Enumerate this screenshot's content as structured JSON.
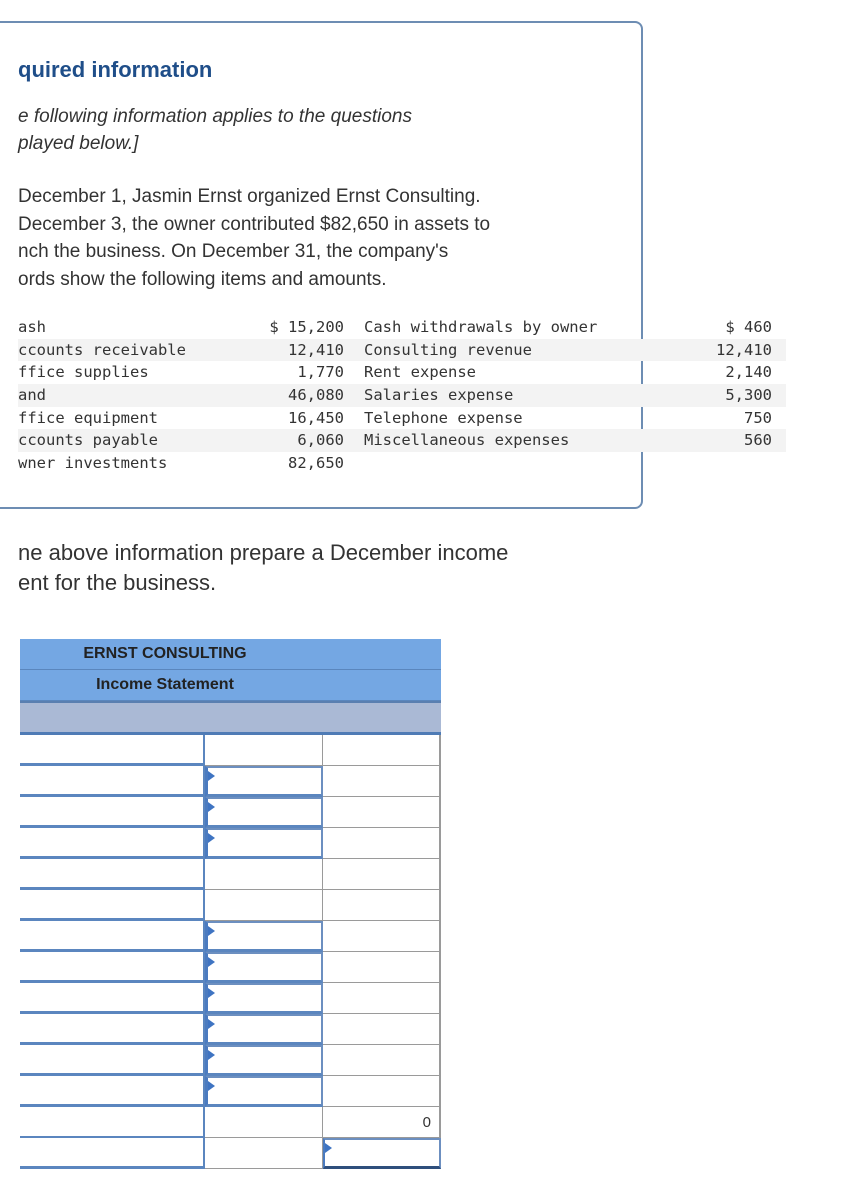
{
  "info_box": {
    "heading": "quired information",
    "intro_lines": [
      "e following information applies to the questions",
      "played below.]"
    ],
    "story_lines": [
      " December 1, Jasmin Ernst organized Ernst Consulting.",
      " December 3, the owner contributed $82,650 in assets to",
      "nch the business. On December 31, the company's",
      "ords show the following items and amounts."
    ],
    "items": [
      {
        "left_label": "ash",
        "left_amount": "$ 15,200",
        "right_label": "Cash withdrawals by owner",
        "right_amount": "$ 460"
      },
      {
        "left_label": "ccounts receivable",
        "left_amount": "12,410",
        "right_label": "Consulting revenue",
        "right_amount": "12,410"
      },
      {
        "left_label": "ffice supplies",
        "left_amount": "1,770",
        "right_label": "Rent expense",
        "right_amount": "2,140"
      },
      {
        "left_label": "and",
        "left_amount": "46,080",
        "right_label": "Salaries expense",
        "right_amount": "5,300"
      },
      {
        "left_label": "ffice equipment",
        "left_amount": "16,450",
        "right_label": "Telephone expense",
        "right_amount": "750"
      },
      {
        "left_label": "ccounts payable",
        "left_amount": "6,060",
        "right_label": "Miscellaneous expenses",
        "right_amount": "560"
      },
      {
        "left_label": "wner investments",
        "left_amount": "82,650",
        "right_label": "",
        "right_amount": ""
      }
    ]
  },
  "instruction_lines": [
    "ne above information prepare a December income",
    "ent for the business."
  ],
  "statement": {
    "company": "ERNST CONSULTING",
    "title": "Income Statement",
    "date_label": "",
    "rows": [
      {
        "mid_input": false,
        "right_input": false,
        "right_value": ""
      },
      {
        "mid_input": true,
        "right_input": false,
        "right_value": ""
      },
      {
        "mid_input": true,
        "right_input": false,
        "right_value": ""
      },
      {
        "mid_input": true,
        "right_input": false,
        "right_value": ""
      },
      {
        "mid_input": false,
        "right_input": false,
        "right_value": ""
      },
      {
        "mid_input": false,
        "right_input": false,
        "right_value": ""
      },
      {
        "mid_input": true,
        "right_input": false,
        "right_value": ""
      },
      {
        "mid_input": true,
        "right_input": false,
        "right_value": ""
      },
      {
        "mid_input": true,
        "right_input": false,
        "right_value": ""
      },
      {
        "mid_input": true,
        "right_input": false,
        "right_value": ""
      },
      {
        "mid_input": true,
        "right_input": false,
        "right_value": ""
      },
      {
        "mid_input": true,
        "right_input": false,
        "right_value": ""
      },
      {
        "mid_input": false,
        "right_input": false,
        "right_value": "0"
      },
      {
        "mid_input": false,
        "right_input": true,
        "right_value": ""
      }
    ]
  }
}
